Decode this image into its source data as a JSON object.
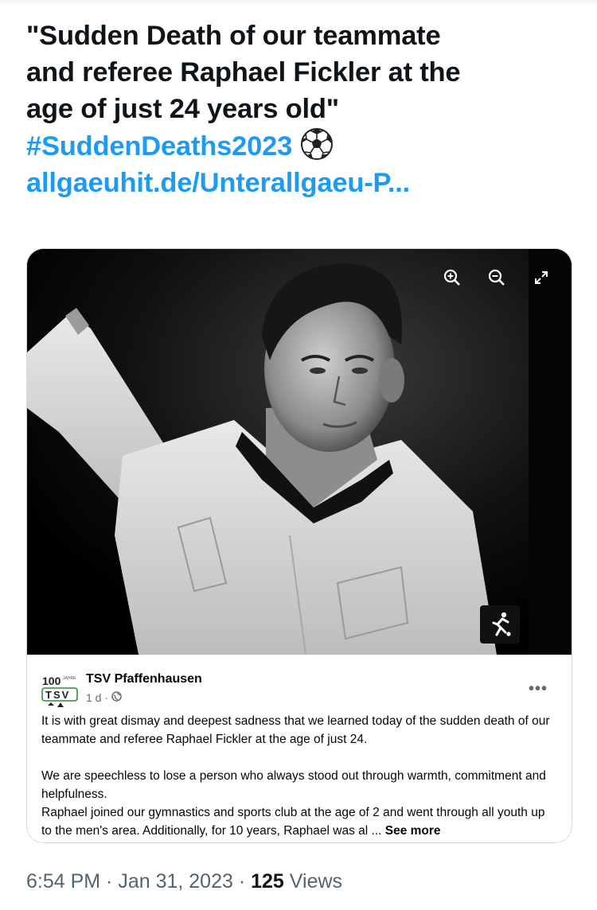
{
  "tweet": {
    "lines": [
      "\"Sudden Death of our teammate",
      "and referee Raphael Fickler at the",
      "age of just 24 years old\""
    ],
    "hashtag": "#SuddenDeaths2023",
    "ball_emoji_icon": "soccer-ball-icon",
    "link": "allgaeuhit.de/Unterallgaeu-P..."
  },
  "media": {
    "viewer_tools": [
      "zoom-in-icon",
      "zoom-out-icon",
      "expand-icon"
    ],
    "badge_icon": "soccer-player-icon"
  },
  "facebook_post": {
    "page_name": "TSV Pfaffenhausen",
    "time": "1 d",
    "separator": "·",
    "logo_text": {
      "top": "100",
      "small": "JAHRE",
      "bottom": "TSV"
    },
    "paragraph1": "It is with great dismay and deepest sadness that we learned today of the sudden death of our teammate and referee Raphael Fickler at the age of just 24.",
    "paragraph2": "We are speechless to lose a person who always stood out through warmth, commitment and helpfulness.",
    "paragraph3": "Raphael joined our gymnastics and sports club at the age of 2 and went through all youth up to the men's area. Additionally, for 10 years, Raphael was al ...",
    "see_more": "See more",
    "more_icon": "more-options-icon"
  },
  "footer": {
    "time": "6:54 PM",
    "dot1": " · ",
    "date": "Jan 31, 2023",
    "dot2": " · ",
    "views_count": "125",
    "views_label": " Views"
  },
  "colors": {
    "link": "#1d9bf0",
    "text": "#0f1419",
    "secondary": "#536471"
  }
}
